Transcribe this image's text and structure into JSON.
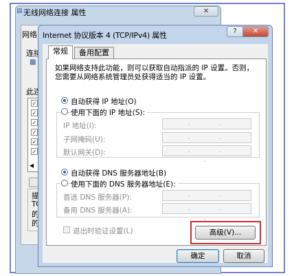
{
  "back_window": {
    "title": "无线网络连接 属性",
    "close_glyph": "✕",
    "tab_label": "网络",
    "connect_label": "连接",
    "items_label": "此连",
    "desc_label": "描",
    "desc_lines": [
      "TC",
      "的",
      "的"
    ]
  },
  "dialog": {
    "title": "Internet 协议版本 4 (TCP/IPv4) 属性",
    "help_glyph": "?",
    "close_glyph": "✕",
    "tabs": [
      {
        "label": "常规"
      },
      {
        "label": "备用配置"
      }
    ],
    "description": "如果网络支持此功能，则可以获取自动指派的 IP 设置。否则，您需要从网络系统管理员处获得适当的 IP 设置。",
    "ip": {
      "auto_label": "自动获得 IP 地址(O)",
      "manual_label": "使用下面的 IP 地址(S):",
      "auto_selected": true,
      "fields": [
        {
          "label": "IP 地址(I):",
          "value": ". . ."
        },
        {
          "label": "子网掩码(U):",
          "value": ". . ."
        },
        {
          "label": "默认网关(D):",
          "value": ". . ."
        }
      ]
    },
    "dns": {
      "auto_label": "自动获得 DNS 服务器地址(B)",
      "manual_label": "使用下面的 DNS 服务器地址(E):",
      "auto_selected": true,
      "fields": [
        {
          "label": "首选 DNS 服务器(P):",
          "value": ". . ."
        },
        {
          "label": "备用 DNS 服务器(A):",
          "value": ". . ."
        }
      ]
    },
    "validate_label": "退出时验证设置(L)",
    "advanced_button": "高级(V)...",
    "ok_button": "确定",
    "cancel_button": "取消"
  },
  "colors": {
    "highlight": "#d12a2a",
    "frame": "#6e7fd6"
  }
}
